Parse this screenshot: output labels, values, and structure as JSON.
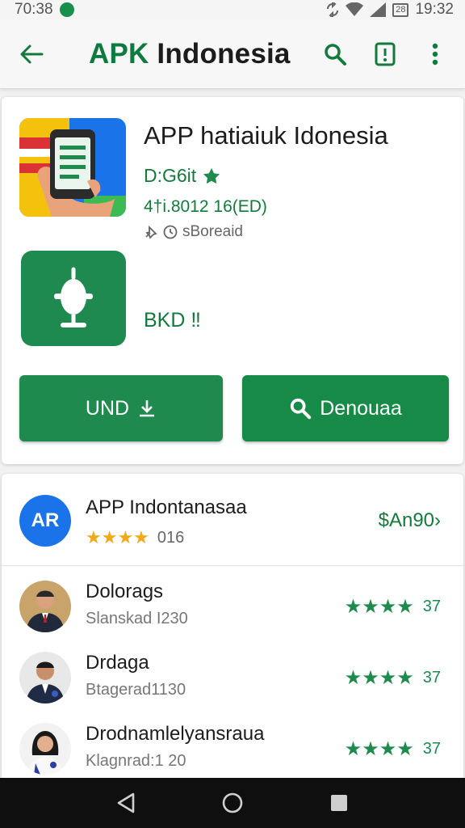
{
  "status": {
    "time": "70:38",
    "clock": "19:32",
    "battery": "28"
  },
  "app_bar": {
    "title_brand": "APK",
    "title_rest": " Indonesia"
  },
  "app": {
    "name": "APP hatiaiuk Idonesia",
    "developer": "D:G6it",
    "code": "4†i.8012 16(ED)",
    "meta": "sBoreaid"
  },
  "secondary": {
    "label": "BKD ‼"
  },
  "buttons": {
    "install": "UND",
    "search": "Denouaa"
  },
  "featured": {
    "initials": "AR",
    "name": "APP Indontanasaa",
    "stars": "★★★★",
    "count": "016",
    "price": "$An90›"
  },
  "reviews": [
    {
      "name": "Dolorags",
      "sub": "Slanskad I230",
      "stars": "★★★★",
      "score": "37"
    },
    {
      "name": "Drdaga",
      "sub": "Btagerad1130",
      "stars": "★★★★",
      "score": "37"
    },
    {
      "name": "Drodnamlelyansraua",
      "sub": "Klagnrad:1 20",
      "stars": "★★★★",
      "score": "37"
    }
  ],
  "colors": {
    "brand_green": "#1e8a4d",
    "text_green": "#137a3c",
    "star_gold": "#f2a818"
  }
}
